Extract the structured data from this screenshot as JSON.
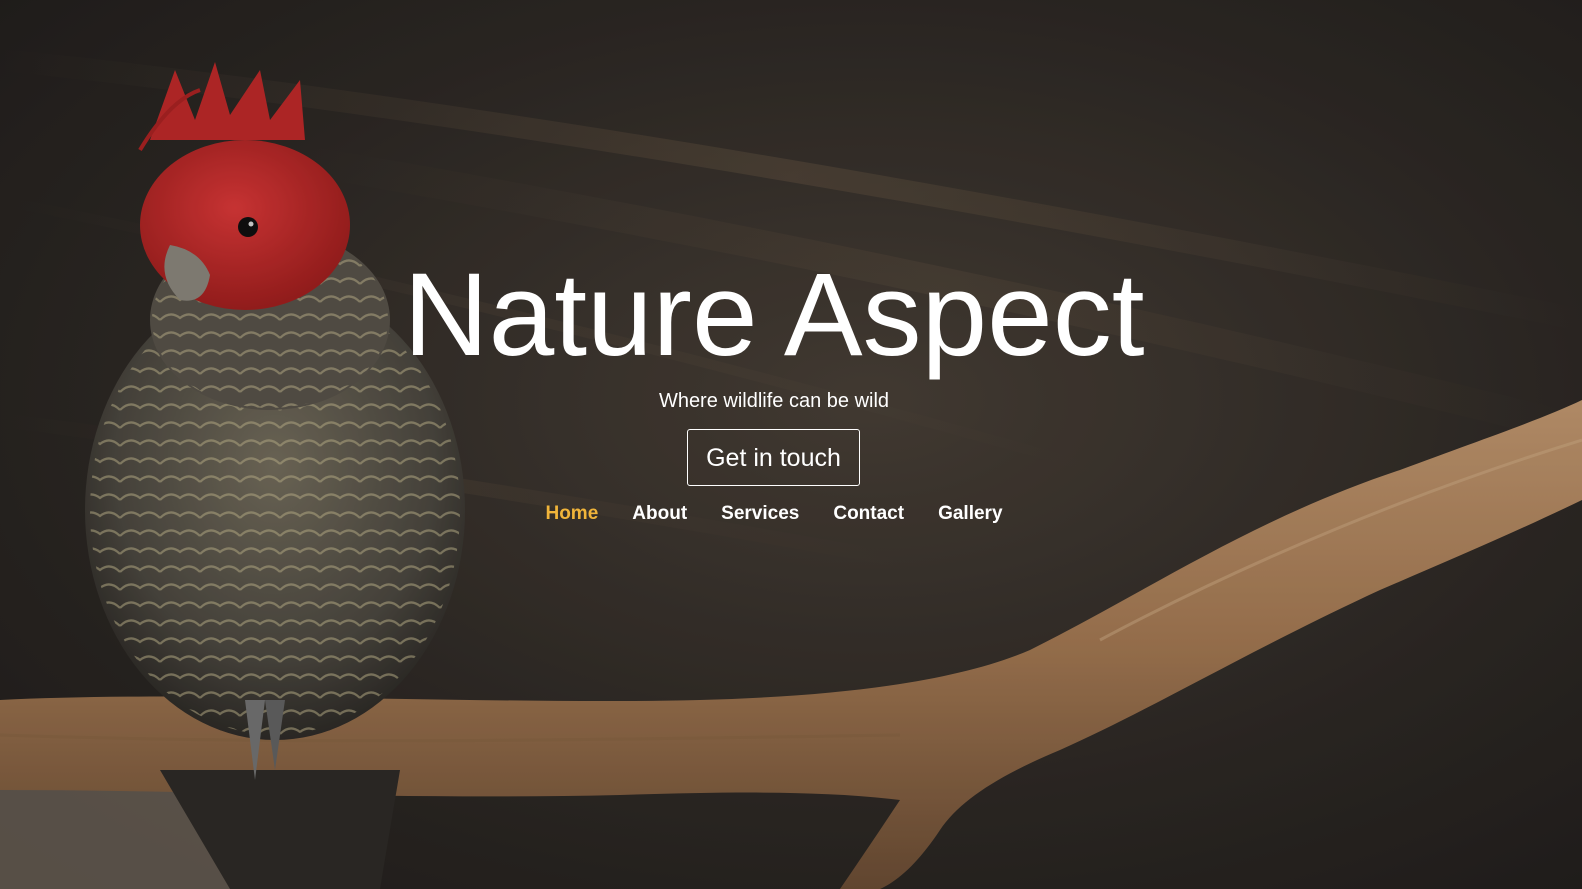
{
  "hero": {
    "title": "Nature Aspect",
    "tagline": "Where wildlife can be wild",
    "cta_label": "Get in touch"
  },
  "nav": {
    "items": [
      {
        "label": "Home",
        "active": true
      },
      {
        "label": "About",
        "active": false
      },
      {
        "label": "Services",
        "active": false
      },
      {
        "label": "Contact",
        "active": false
      },
      {
        "label": "Gallery",
        "active": false
      }
    ]
  },
  "colors": {
    "accent": "#f0b43a",
    "text": "#ffffff",
    "background": "#2a2623"
  }
}
